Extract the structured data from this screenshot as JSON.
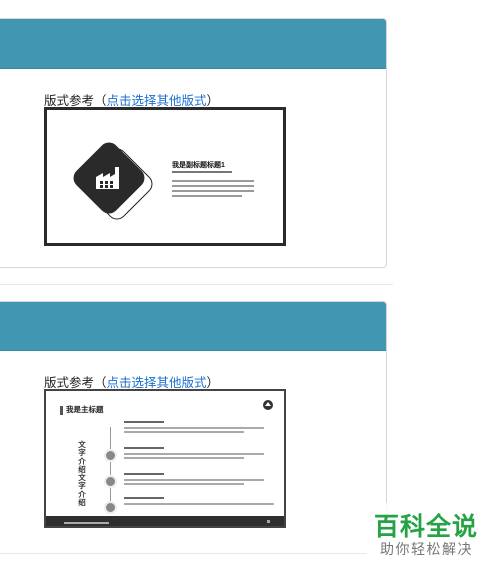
{
  "sections": [
    {
      "ref_label": "版式参考",
      "ref_paren_open": "（",
      "ref_link": "点击选择其他版式",
      "ref_paren_close": "）",
      "thumbnail": {
        "title": "我是副标题标题1"
      }
    },
    {
      "ref_label": "版式参考",
      "ref_paren_open": "（",
      "ref_link": "点击选择其他版式",
      "ref_paren_close": "）",
      "thumbnail": {
        "title": "我是主标题",
        "vertical_text": "文字介绍文字介绍"
      }
    }
  ],
  "watermark": {
    "title": "百科全说",
    "subtitle": "助你轻松解决"
  },
  "colors": {
    "header": "#4197b1",
    "link": "#1a6fd1",
    "watermark_green": "#25a244"
  }
}
